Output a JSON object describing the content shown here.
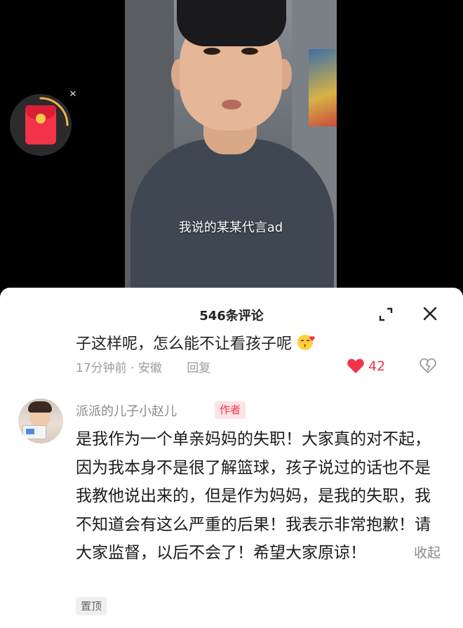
{
  "video": {
    "subtitle": "我说的某某代言ad"
  },
  "red_packet": {
    "icon": "red-envelope-icon",
    "close_icon": "close-icon",
    "colors": {
      "envelope": "#f2334a",
      "ring": "#f0b64a"
    }
  },
  "comments_panel": {
    "title": "546条评论",
    "expand_icon": "expand-icon",
    "close_icon": "close-icon"
  },
  "previous_comment": {
    "text_visible": "子这样呢，怎么能不让看孩子呢",
    "emoji": "kissing-face-icon",
    "time": "17分钟前",
    "location": "安徽",
    "reply_label": "回复",
    "like_count": "42",
    "like_color": "#f2334a"
  },
  "author_comment": {
    "username": "派派的儿子小赵儿",
    "badge": "作者",
    "text": "是我作为一个单亲妈妈的失职！大家真的对不起，因为我本身不是很了解篮球，孩子说过的话也不是我教他说出来的，但是作为妈妈，是我的失职，我不知道会有这么严重的后果！我表示非常抱歉！请大家监督，以后不会了！希望大家原谅！",
    "collapse_label": "收起",
    "pinned_label": "置顶"
  }
}
